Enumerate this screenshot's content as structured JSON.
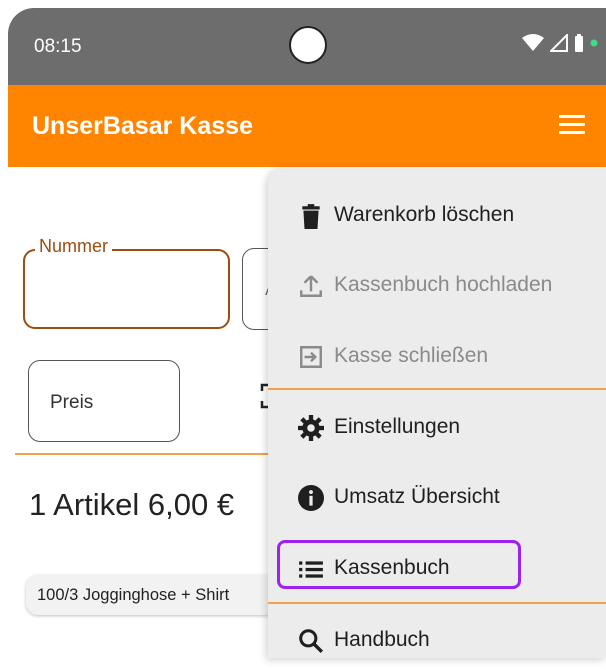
{
  "status_bar": {
    "time": "08:15"
  },
  "app_bar": {
    "title": "UnserBasar Kasse",
    "menu_icon": "hamburger-menu-icon"
  },
  "form": {
    "nummer_label": "Nummer",
    "nummer_value": "",
    "second_field_hint": "A",
    "preis_label": "Preis",
    "scan_icon": "barcode-scan-icon"
  },
  "cart": {
    "summary": "1 Artikel 6,00 €",
    "items": [
      {
        "text": "100/3  Jogginghose + Shirt"
      }
    ]
  },
  "menu": {
    "items": [
      {
        "label": "Warenkorb löschen",
        "icon": "trash-icon",
        "enabled": true
      },
      {
        "label": "Kassenbuch hochladen",
        "icon": "upload-icon",
        "enabled": false
      },
      {
        "label": "Kasse schließen",
        "icon": "exit-icon",
        "enabled": false
      },
      {
        "label": "Einstellungen",
        "icon": "gear-icon",
        "enabled": true
      },
      {
        "label": "Umsatz Übersicht",
        "icon": "info-icon",
        "enabled": true
      },
      {
        "label": "Kassenbuch",
        "icon": "list-icon",
        "enabled": true
      },
      {
        "label": "Handbuch",
        "icon": "search-icon",
        "enabled": true
      }
    ]
  },
  "colors": {
    "accent": "#ff8500",
    "status_bar": "#6d6d6d",
    "highlight": "#a020f0",
    "field_border": "#9c4d12"
  }
}
